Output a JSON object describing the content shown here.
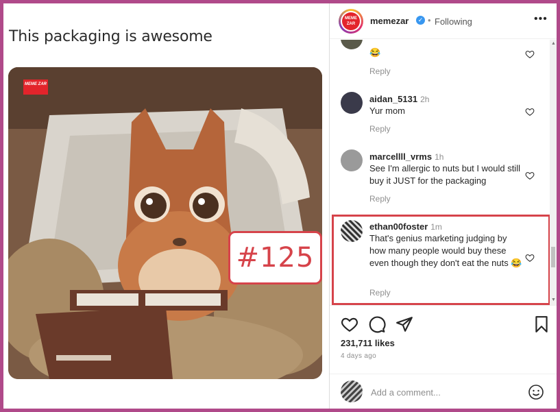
{
  "post": {
    "title": "This packaging is awesome",
    "badge": "#125",
    "watermark": "MEME ZAR"
  },
  "header": {
    "username": "memezar",
    "verified_mark": "✓",
    "separator": "•",
    "follow_status": "Following",
    "more_label": "•••",
    "avatar_text": "MEME ZAR"
  },
  "comments": [
    {
      "username": "",
      "time": "",
      "text": "😂",
      "reply": "Reply"
    },
    {
      "username": "aidan_5131",
      "time": "2h",
      "text": "Yur mom",
      "reply": "Reply"
    },
    {
      "username": "marcellll_vrms",
      "time": "1h",
      "text": "See I'm allergic to nuts but I would still buy it JUST for the packaging",
      "reply": "Reply"
    },
    {
      "username": "ethan00foster",
      "time": "1m",
      "text": "That's genius marketing judging by how many people would buy these even though they don't eat the nuts 😂",
      "reply": "Reply"
    }
  ],
  "actions": {
    "likes": "231,711 likes",
    "posted_ago": "4 days ago"
  },
  "add_comment": {
    "placeholder": "Add a comment..."
  },
  "colors": {
    "frame_border": "#b04a8a",
    "highlight": "#d6434a",
    "verified": "#3897f0"
  }
}
